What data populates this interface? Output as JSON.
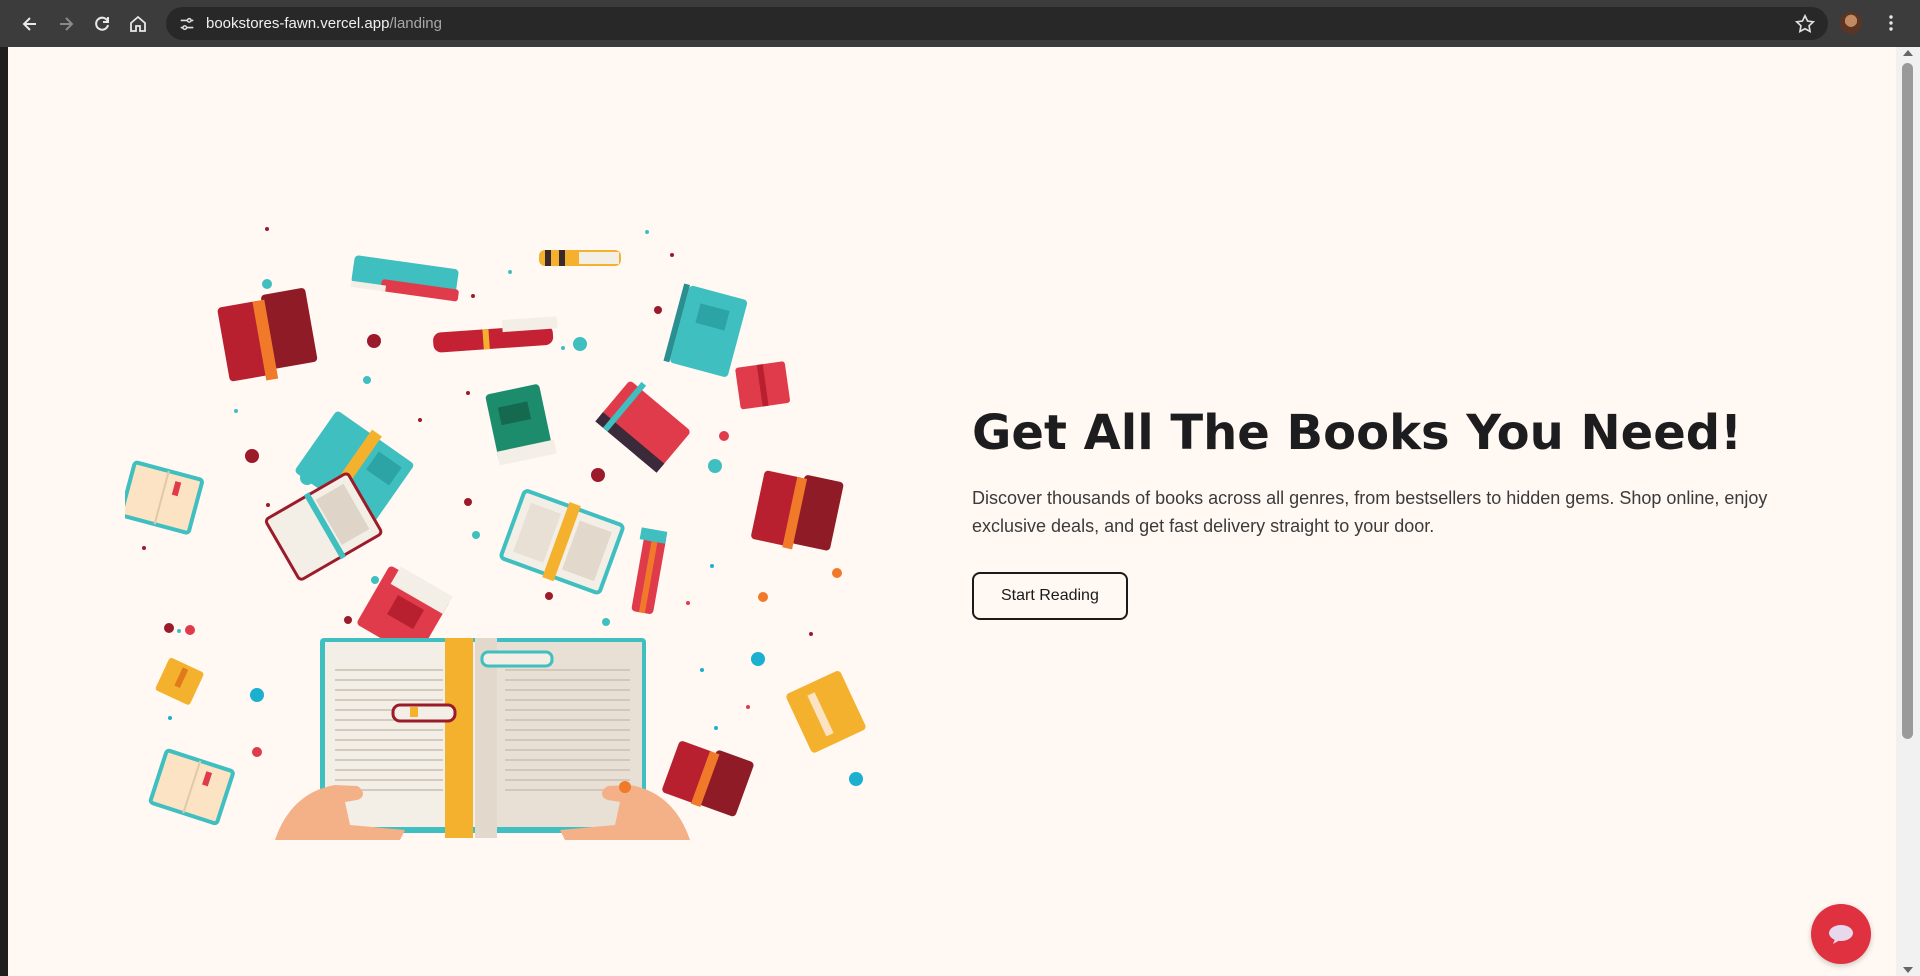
{
  "browser": {
    "url_host": "bookstores-fawn.vercel.app",
    "url_path": "/landing"
  },
  "hero": {
    "title": "Get All The Books You Need!",
    "description": "Discover thousands of books across all genres, from bestsellers to hidden gems. Shop online, enjoy exclusive deals, and get fast delivery straight to your door.",
    "cta_label": "Start Reading"
  },
  "colors": {
    "page_bg": "#fff8f3",
    "title": "#1d1d1f",
    "chat_button": "#e03140",
    "book_teal": "#3fbfc0",
    "book_red": "#e03b4b",
    "book_darkred": "#8e1b26",
    "book_yellow": "#f4b12e"
  },
  "icons": {
    "back": "arrow-left-icon",
    "forward": "arrow-right-icon",
    "reload": "reload-icon",
    "home": "home-icon",
    "site_info": "tune-icon",
    "bookmark": "star-icon",
    "menu": "kebab-menu-icon",
    "chat": "chat-bubble-icon"
  }
}
